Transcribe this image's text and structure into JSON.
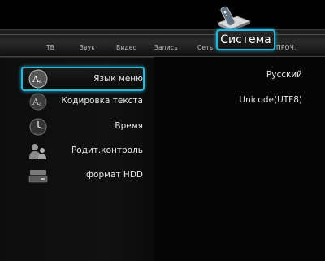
{
  "tabs": [
    {
      "id": "tv",
      "label": "ТВ"
    },
    {
      "id": "sound",
      "label": "Звук"
    },
    {
      "id": "video",
      "label": "Видео"
    },
    {
      "id": "rec",
      "label": "Запись"
    },
    {
      "id": "net",
      "label": "Сеть"
    },
    {
      "id": "misc",
      "label": "ПРОЧ."
    }
  ],
  "active_tab": {
    "label": "Система",
    "icon": "remote-and-box-icon"
  },
  "menu": [
    {
      "label": "Язык меню",
      "icon": "language-icon",
      "selected": true
    },
    {
      "label": "Кодировка текста",
      "icon": "text-encoding-icon",
      "selected": false
    },
    {
      "label": "Время",
      "icon": "clock-icon",
      "selected": false
    },
    {
      "label": "Родит.контроль",
      "icon": "parental-control-icon",
      "selected": false
    },
    {
      "label": "формат HDD",
      "icon": "hdd-icon",
      "selected": false
    }
  ],
  "values": {
    "menu_language": "Русский",
    "text_encoding": "Unicode(UTF8)"
  },
  "colors": {
    "accent": "#2bb6d8",
    "background": "#050505"
  }
}
